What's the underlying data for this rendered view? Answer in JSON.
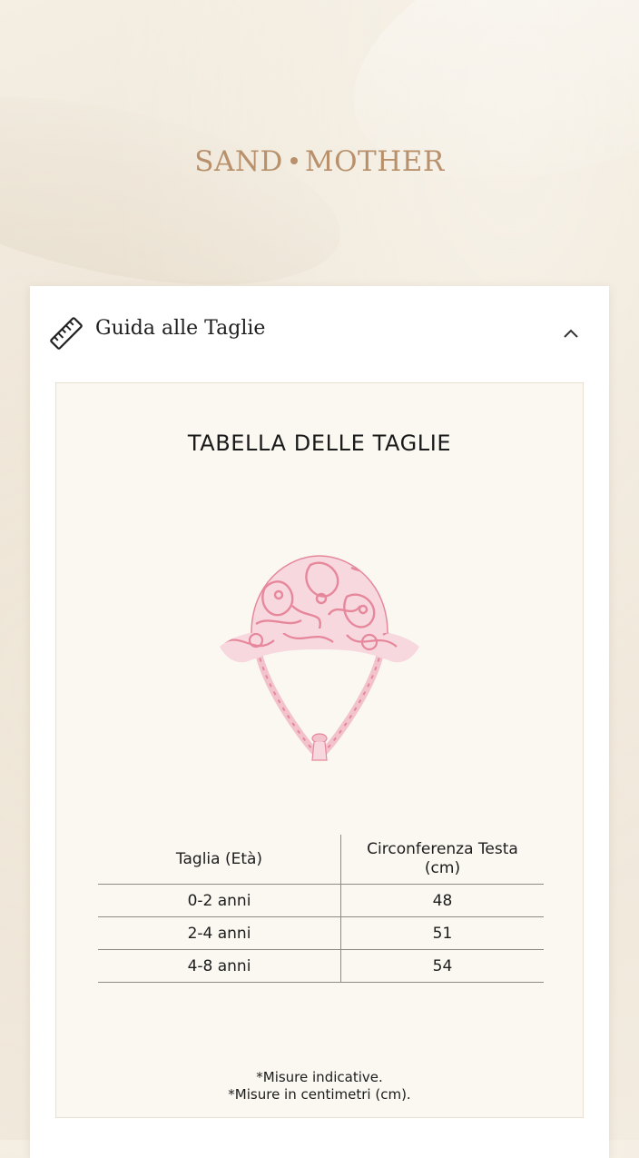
{
  "brand": {
    "left": "SAND",
    "right": "MOTHER",
    "color": "#b8916c"
  },
  "accordion": {
    "title": "Guida alle Taglie",
    "icon": "ruler-icon",
    "toggle_icon": "chevron-up-icon",
    "expanded": true
  },
  "size_chart": {
    "title": "TABELLA DELLE TAGLIE",
    "image": "pink-floral-bucket-hat",
    "headers": {
      "size": "Taglia (Età)",
      "head": "Circonferenza Testa (cm)"
    },
    "rows": [
      {
        "size": "0-2 anni",
        "head": "48"
      },
      {
        "size": "2-4 anni",
        "head": "51"
      },
      {
        "size": "4-8 anni",
        "head": "54"
      }
    ],
    "notes": [
      "*Misure indicative.",
      "*Misure in centimetri (cm)."
    ]
  },
  "colors": {
    "hat_pink": "#e6879b",
    "hat_light": "#f7d8df"
  }
}
